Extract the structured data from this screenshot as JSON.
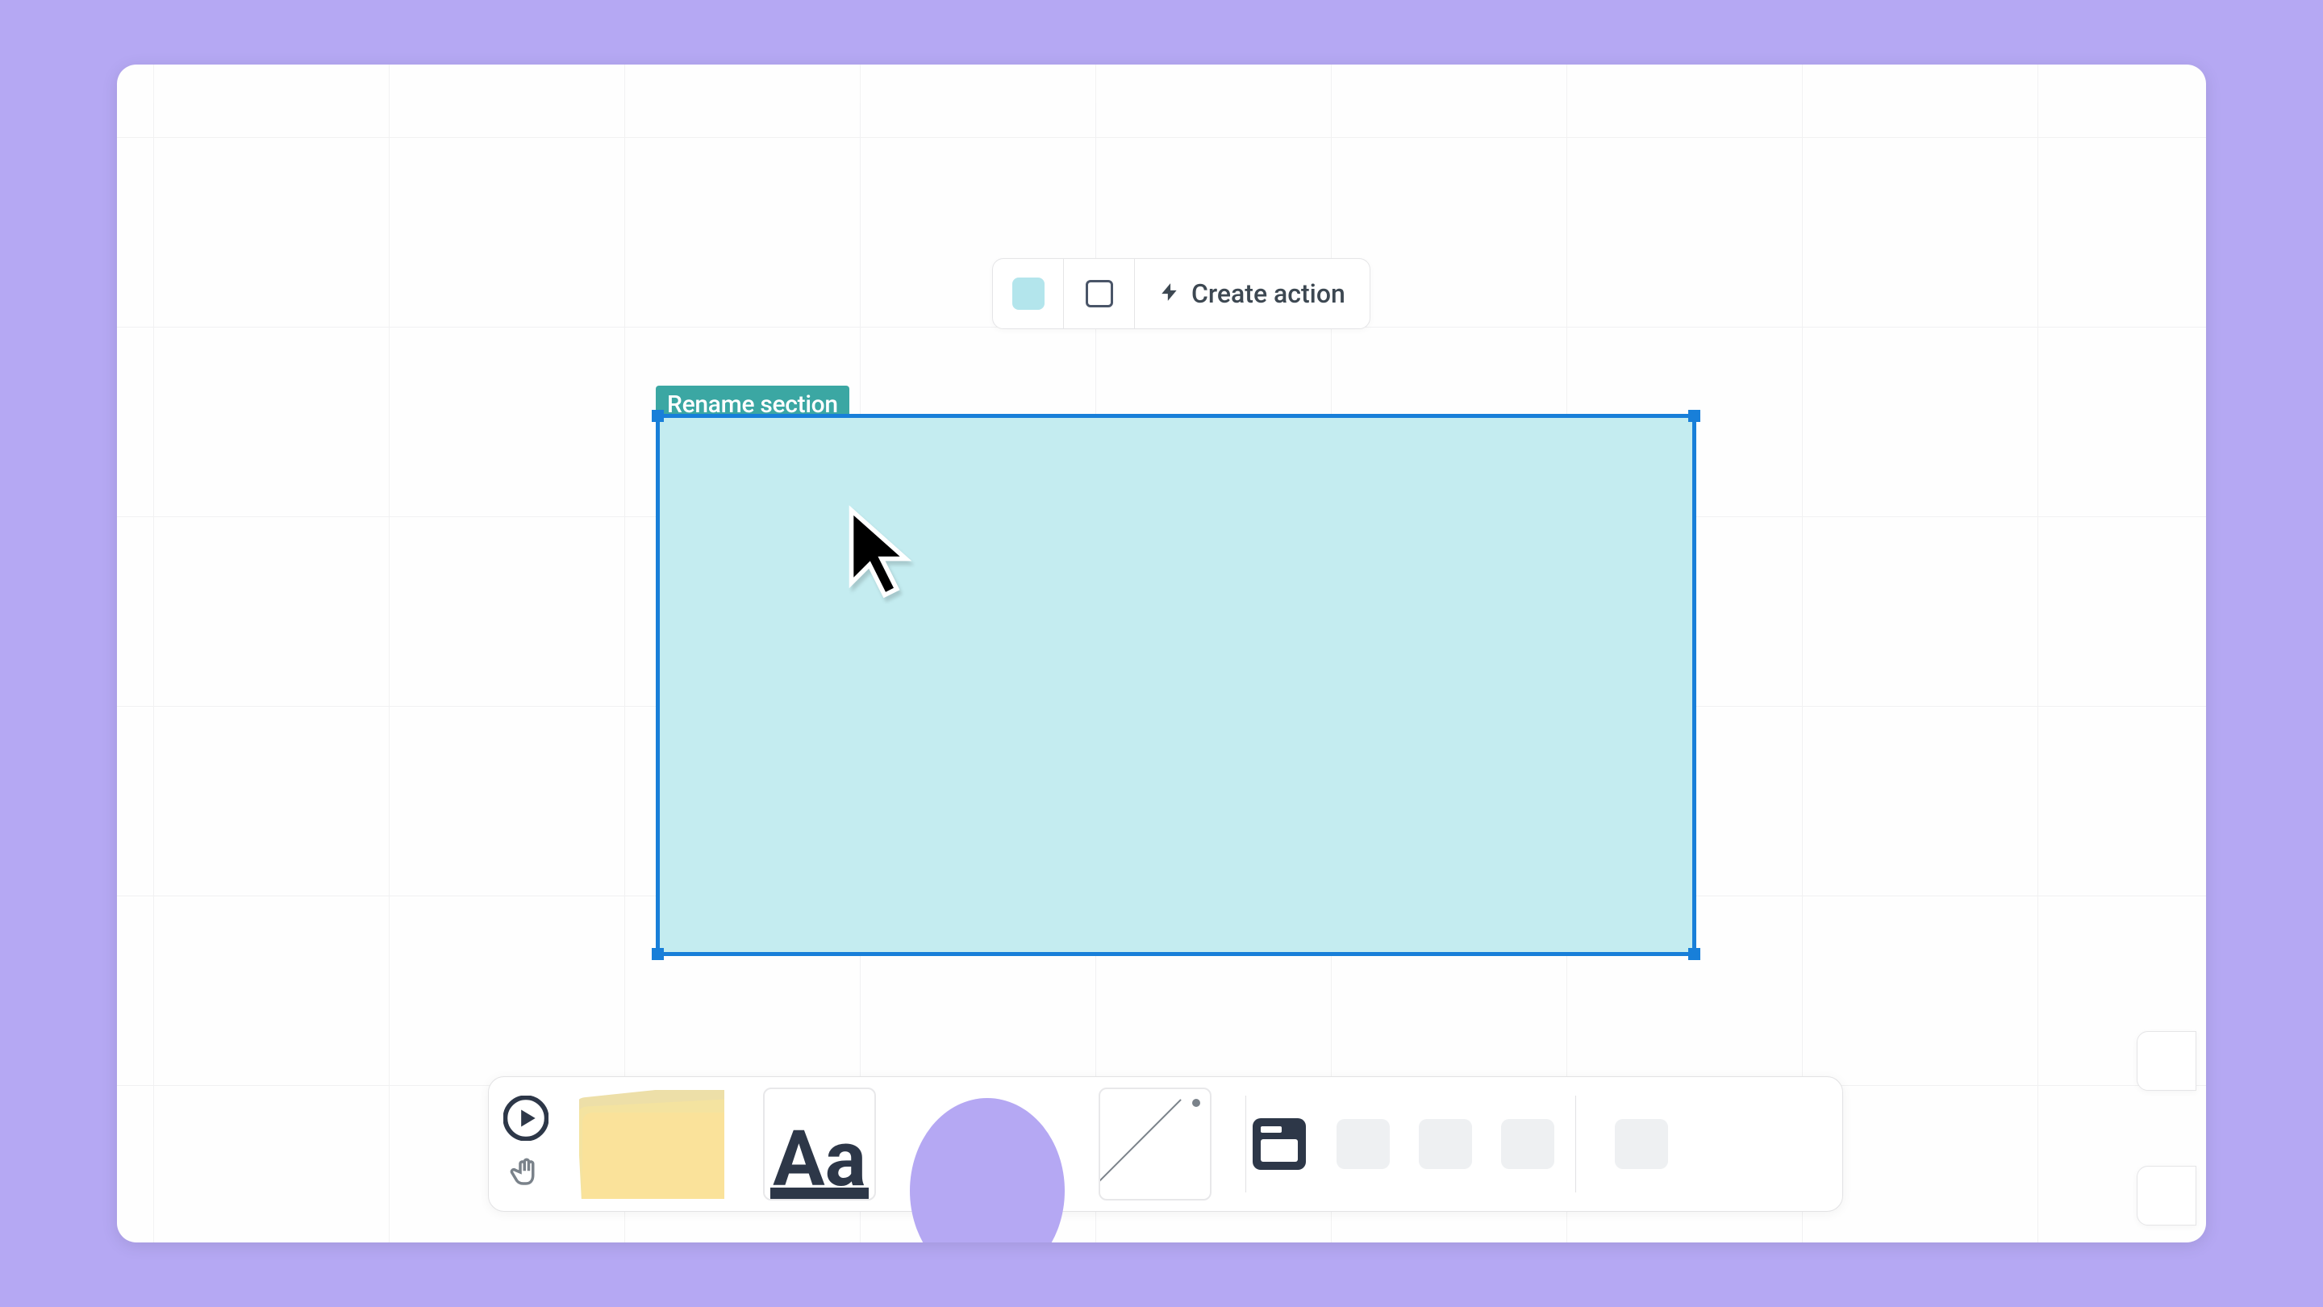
{
  "context_toolbar": {
    "color_swatch": "#b3e5ec",
    "create_action_label": "Create action"
  },
  "section": {
    "label_text": "Rename section",
    "fill_color": "#c4ecf0",
    "border_color": "#187fd9"
  },
  "cursor": {
    "name": "pointer"
  },
  "bottom_toolbar": {
    "text_tool_glyph": "Aa"
  },
  "colors": {
    "page_bg": "#b5a8f3",
    "canvas_bg": "#fefefe",
    "section_label_bg": "#3ba7a3"
  }
}
